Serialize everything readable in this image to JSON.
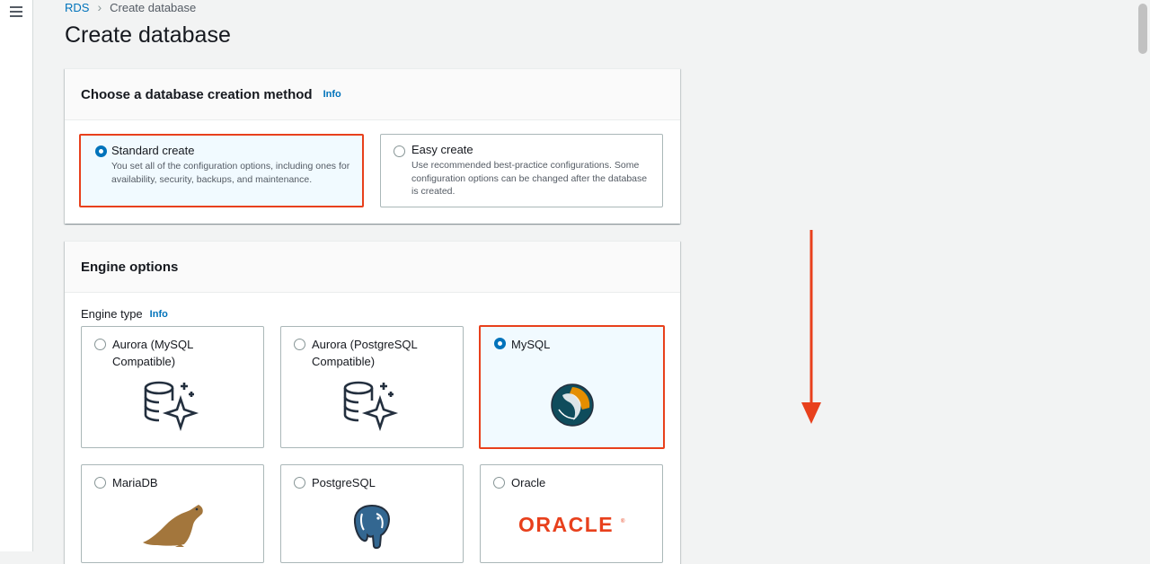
{
  "breadcrumb": {
    "root": "RDS",
    "current": "Create database"
  },
  "page_title": "Create database",
  "method_panel": {
    "title": "Choose a database creation method",
    "info": "Info",
    "options": [
      {
        "title": "Standard create",
        "description": "You set all of the configuration options, including ones for availability, security, backups, and maintenance.",
        "selected": true
      },
      {
        "title": "Easy create",
        "description": "Use recommended best-practice configurations. Some configuration options can be changed after the database is created.",
        "selected": false
      }
    ]
  },
  "engine_panel": {
    "title": "Engine options",
    "engine_type_label": "Engine type",
    "info": "Info",
    "engines": [
      {
        "name": "Aurora (MySQL Compatible)",
        "icon": "aurora-db-icon",
        "selected": false
      },
      {
        "name": "Aurora (PostgreSQL Compatible)",
        "icon": "aurora-db-icon",
        "selected": false
      },
      {
        "name": "MySQL",
        "icon": "mysql-dolphin-logo",
        "selected": true
      },
      {
        "name": "MariaDB",
        "icon": "mariadb-seal-logo",
        "selected": false
      },
      {
        "name": "PostgreSQL",
        "icon": "postgresql-elephant-logo",
        "selected": false
      },
      {
        "name": "Oracle",
        "icon": "oracle-wordmark-logo",
        "selected": false
      }
    ],
    "oracle_wordmark": "ORACLE"
  },
  "annotation": {
    "icon": "red-down-arrow",
    "color": "#e8401c"
  },
  "colors": {
    "accent": "#0073bb",
    "highlight": "#e8401c",
    "selected_bg": "#f1faff"
  }
}
